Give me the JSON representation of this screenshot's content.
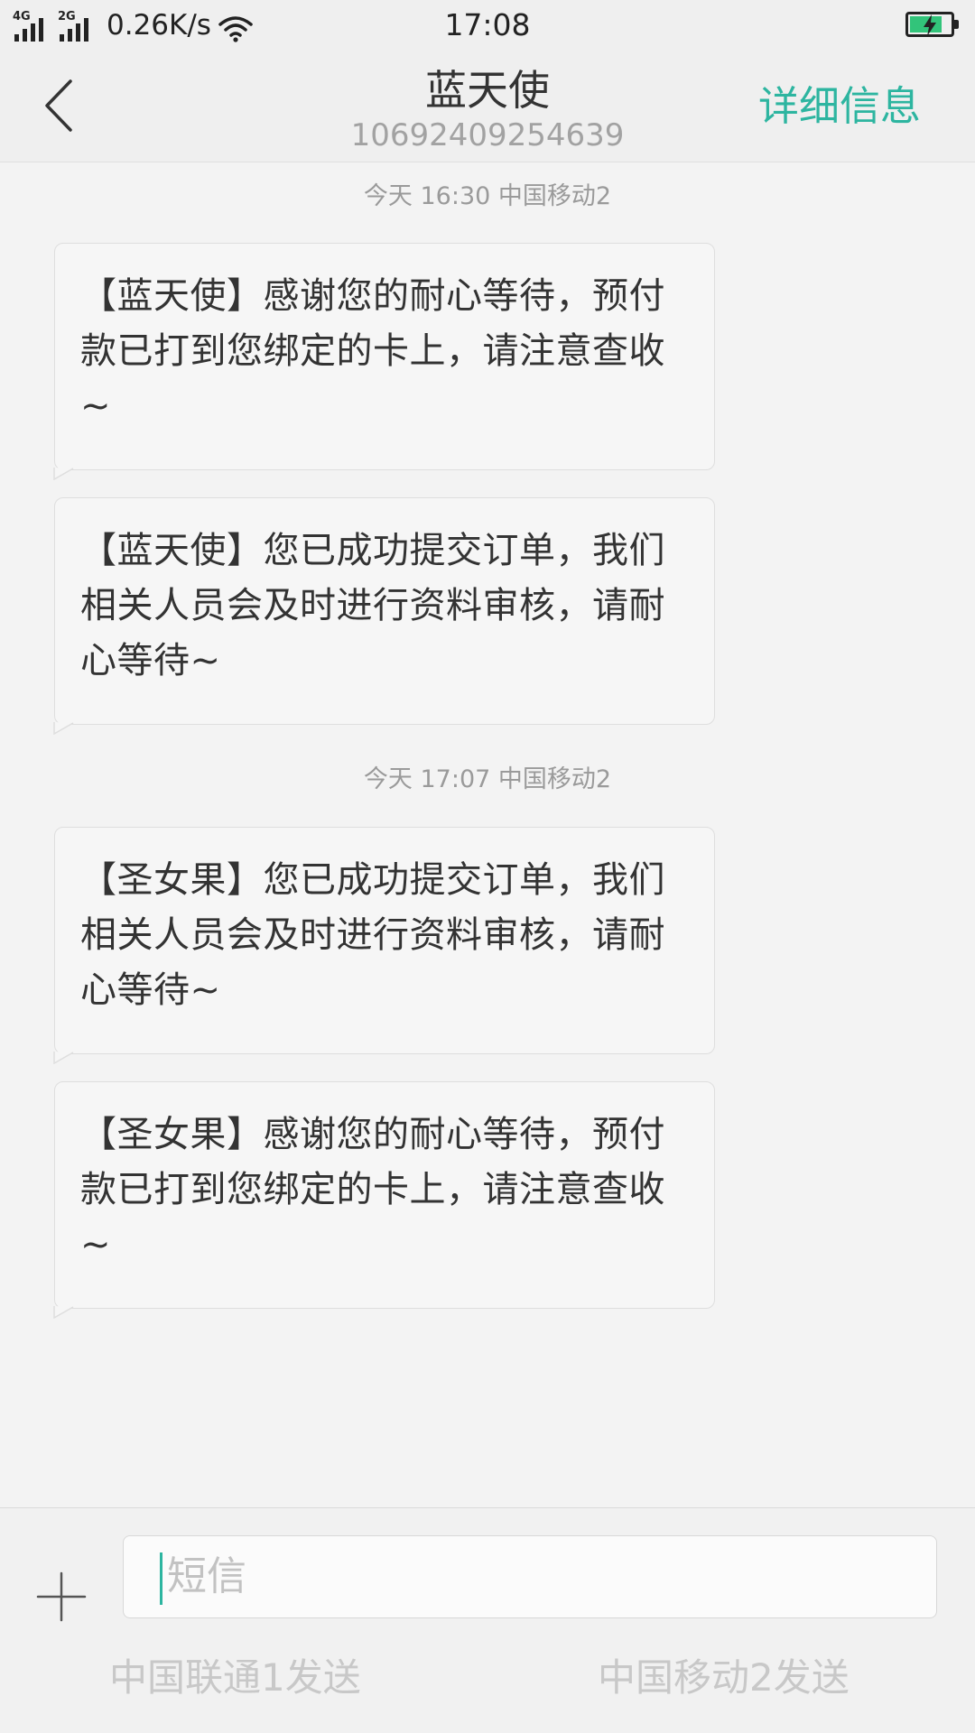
{
  "status_bar": {
    "network_1": "4G",
    "network_2": "2G",
    "speed": "0.26K/s",
    "time": "17:08",
    "icons": [
      "signal-icon",
      "signal-icon",
      "wifi-icon",
      "battery-charging-icon"
    ],
    "battery_level": 0.8
  },
  "header": {
    "back_icon": "back-chevron-icon",
    "contact_name": "蓝天使",
    "contact_number": "10692409254639",
    "details_label": "详细信息"
  },
  "thread": {
    "timestamps": [
      {
        "text": "今天  16:30  中国移动2"
      },
      {
        "text": "今天  17:07  中国移动2"
      }
    ],
    "messages": [
      {
        "text": "【蓝天使】感谢您的耐心等待，预付款已打到您绑定的卡上，请注意查收~"
      },
      {
        "text": "【蓝天使】您已成功提交订单，我们相关人员会及时进行资料审核，请耐心等待~"
      },
      {
        "text": "【圣女果】您已成功提交订单，我们相关人员会及时进行资料审核，请耐心等待~"
      },
      {
        "text": "【圣女果】感谢您的耐心等待，预付款已打到您绑定的卡上，请注意查收~"
      }
    ]
  },
  "compose": {
    "add_icon": "plus-icon",
    "placeholder": "短信",
    "send_sim1": "中国联通1发送",
    "send_sim2": "中国移动2发送"
  },
  "colors": {
    "accent": "#2db5a0",
    "battery_fill": "#32c47a"
  }
}
